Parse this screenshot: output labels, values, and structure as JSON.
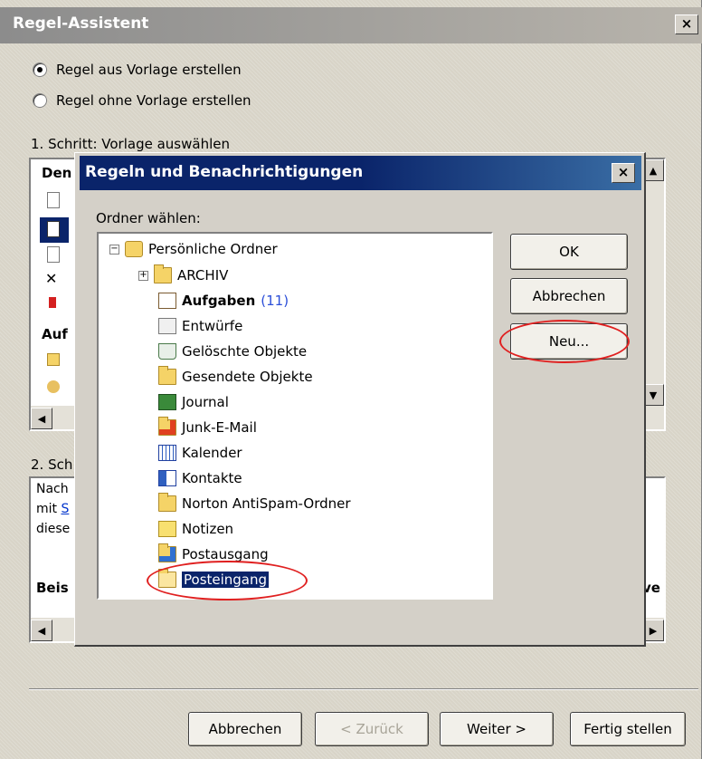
{
  "outer": {
    "title": "Regel-Assistent",
    "close_glyph": "×",
    "radio_from_template": "Regel aus Vorlage erstellen",
    "radio_without_template": "Regel ohne Vorlage erstellen",
    "step1_label": "1. Schritt: Vorlage auswählen",
    "step1_group_head": "Den",
    "step1_group2_head": "Auf",
    "step2_label": "2. Sch",
    "step2_line1": "Nach",
    "step2_line2_prefix": "mit ",
    "step2_line2_link": "S",
    "step2_line3": "diese",
    "step2_bold_left": "Beis",
    "step2_bold_right": "ve",
    "buttons": {
      "cancel": "Abbrechen",
      "back": "< Zurück",
      "next": "Weiter >",
      "finish": "Fertig stellen"
    }
  },
  "dialog": {
    "title": "Regeln und Benachrichtigungen",
    "close_glyph": "×",
    "folder_label": "Ordner wählen:",
    "root": "Persönliche Ordner",
    "items": [
      {
        "label": "ARCHIV",
        "icon": "folder-icon",
        "expandable": true
      },
      {
        "label": "Aufgaben",
        "icon": "tasks-icon",
        "bold": true,
        "count": "(11)"
      },
      {
        "label": "Entwürfe",
        "icon": "drafts-icon"
      },
      {
        "label": "Gelöschte Objekte",
        "icon": "trash-icon"
      },
      {
        "label": "Gesendete Objekte",
        "icon": "sent-icon"
      },
      {
        "label": "Journal",
        "icon": "journal-icon"
      },
      {
        "label": "Junk-E-Mail",
        "icon": "junk-icon"
      },
      {
        "label": "Kalender",
        "icon": "calendar-icon"
      },
      {
        "label": "Kontakte",
        "icon": "contacts-icon"
      },
      {
        "label": "Norton AntiSpam-Ordner",
        "icon": "folder-icon"
      },
      {
        "label": "Notizen",
        "icon": "notes-icon"
      },
      {
        "label": "Postausgang",
        "icon": "outbox-icon"
      },
      {
        "label": "Posteingang",
        "icon": "inbox-icon",
        "selected": true
      }
    ],
    "buttons": {
      "ok": "OK",
      "cancel": "Abbrechen",
      "new": "Neu..."
    }
  },
  "colors": {
    "highlight_ring": "#e02020",
    "selection": "#0a246a",
    "count": "#2c4fd8"
  }
}
